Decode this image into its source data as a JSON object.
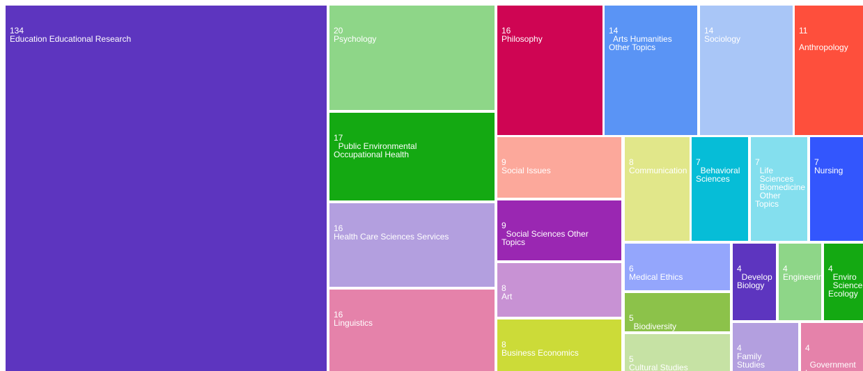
{
  "chart_data": {
    "type": "treemap",
    "items": [
      {
        "value": "134",
        "label": "Education Educational Research",
        "color": "#5d35bf"
      },
      {
        "value": "20",
        "label": "Psychology",
        "color": "#8ed688"
      },
      {
        "value": "16",
        "label": "Philosophy",
        "color": "#cf0553"
      },
      {
        "value": "14",
        "label": "  Arts Humanities\nOther Topics",
        "color": "#5a94f5"
      },
      {
        "value": "14",
        "label": "Sociology",
        "color": "#a9c6f7"
      },
      {
        "value": "11",
        "label": "\nAnthropology",
        "color": "#fe4f3c"
      },
      {
        "value": "17",
        "label": "  Public Environmental\nOccupational Health",
        "color": "#14a912"
      },
      {
        "value": "9",
        "label": "Social Issues",
        "color": "#fca89b"
      },
      {
        "value": "8",
        "label": "Communication",
        "color": "#e1e78a"
      },
      {
        "value": "7",
        "label": "  Behavioral\nSciences",
        "color": "#06bdd7"
      },
      {
        "value": "7",
        "label": "  Life\n  Sciences\n  Biomedicine\n  Other\nTopics",
        "color": "#84dfee"
      },
      {
        "value": "7",
        "label": "Nursing",
        "color": "#3356fd"
      },
      {
        "value": "16",
        "label": "Health Care Sciences Services",
        "color": "#b39fdf"
      },
      {
        "value": "9",
        "label": "  Social Sciences Other\nTopics",
        "color": "#9a27b2"
      },
      {
        "value": "6",
        "label": "Medical Ethics",
        "color": "#94a6fc"
      },
      {
        "value": "4",
        "label": "  Develop\nBiology",
        "color": "#5d35bf"
      },
      {
        "value": "4",
        "label": "Engineering",
        "color": "#8ed688"
      },
      {
        "value": "4",
        "label": "  Enviro\n  Science\nEcology",
        "color": "#14a912"
      },
      {
        "value": "8",
        "label": "Art",
        "color": "#c892d4"
      },
      {
        "value": "16",
        "label": "Linguistics",
        "color": "#e582aa"
      },
      {
        "value": "5",
        "label": "  Biodiversity\n  Conservation",
        "color": "#8cc24a"
      },
      {
        "value": "8",
        "label": "Business Economics",
        "color": "#ccdb38"
      },
      {
        "value": "5",
        "label": "Cultural Studies",
        "color": "#c6e2a4"
      },
      {
        "value": "4",
        "label": "Family\nStudies",
        "color": "#b39fdf"
      },
      {
        "value": "4",
        "label": "\n  Government\nLaw",
        "color": "#e582aa"
      }
    ]
  }
}
